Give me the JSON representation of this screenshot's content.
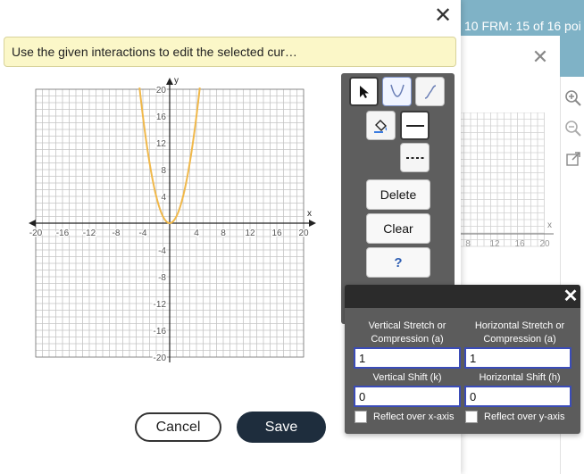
{
  "background": {
    "topbar_text": "10 FRM: 15 of 16 poi",
    "x_tick_labels": [
      "8",
      "12",
      "16",
      "20"
    ],
    "x_axis_label": "x",
    "rail_icons": [
      "zoom-in-icon",
      "zoom-out-icon",
      "external-link-icon"
    ]
  },
  "dialog": {
    "instruction": "Use the given interactions to edit the selected cur…"
  },
  "toolbar": {
    "tools": [
      "arrow-pointer-icon",
      "parabola-icon",
      "curve-icon",
      "paint-bucket-icon",
      "solid-line-icon",
      "dashed-line-icon"
    ],
    "delete_label": "Delete",
    "clear_label": "Clear",
    "help_label": "?"
  },
  "transform_panel": {
    "vertical_stretch_label": "Vertical Stretch or Compression (a)",
    "vertical_stretch_value": "1",
    "horizontal_stretch_label": "Horizontal Stretch or Compression (a)",
    "horizontal_stretch_value": "1",
    "vertical_shift_label": "Vertical Shift (k)",
    "vertical_shift_value": "0",
    "horizontal_shift_label": "Horizontal Shift (h)",
    "horizontal_shift_value": "0",
    "reflect_x_label": "Reflect over x-axis",
    "reflect_y_label": "Reflect over y-axis",
    "reflect_x_checked": false,
    "reflect_y_checked": false
  },
  "buttons": {
    "cancel_label": "Cancel",
    "save_label": "Save"
  },
  "colors": {
    "curve": "#f0b84a",
    "accent_input_border": "#3b4cb8",
    "save_bg": "#1e2d3d",
    "instruction_bg": "#fbf7c8"
  },
  "chart_data": {
    "type": "line",
    "xlim": [
      -20,
      20
    ],
    "ylim": [
      -20,
      20
    ],
    "grid": true,
    "x_ticks": [
      -20,
      -16,
      -12,
      -8,
      -4,
      4,
      8,
      12,
      16,
      20
    ],
    "y_ticks": [
      -20,
      -16,
      -12,
      -8,
      -4,
      4,
      8,
      12,
      16,
      20
    ],
    "x_tick_labels": [
      "-20",
      "-16",
      "-12",
      "-8",
      "-4",
      "4",
      "8",
      "12",
      "16",
      "20"
    ],
    "y_tick_labels": [
      "-20",
      "-16",
      "-12",
      "-8",
      "-4",
      "4",
      "8",
      "12",
      "16",
      "20"
    ],
    "xlabel": "x",
    "ylabel": "y",
    "series": [
      {
        "function": "y = a(x - h)^2 + k",
        "a": 1,
        "h": 0,
        "k": 0,
        "x_range": [
          -4.5,
          4.5
        ]
      }
    ]
  }
}
